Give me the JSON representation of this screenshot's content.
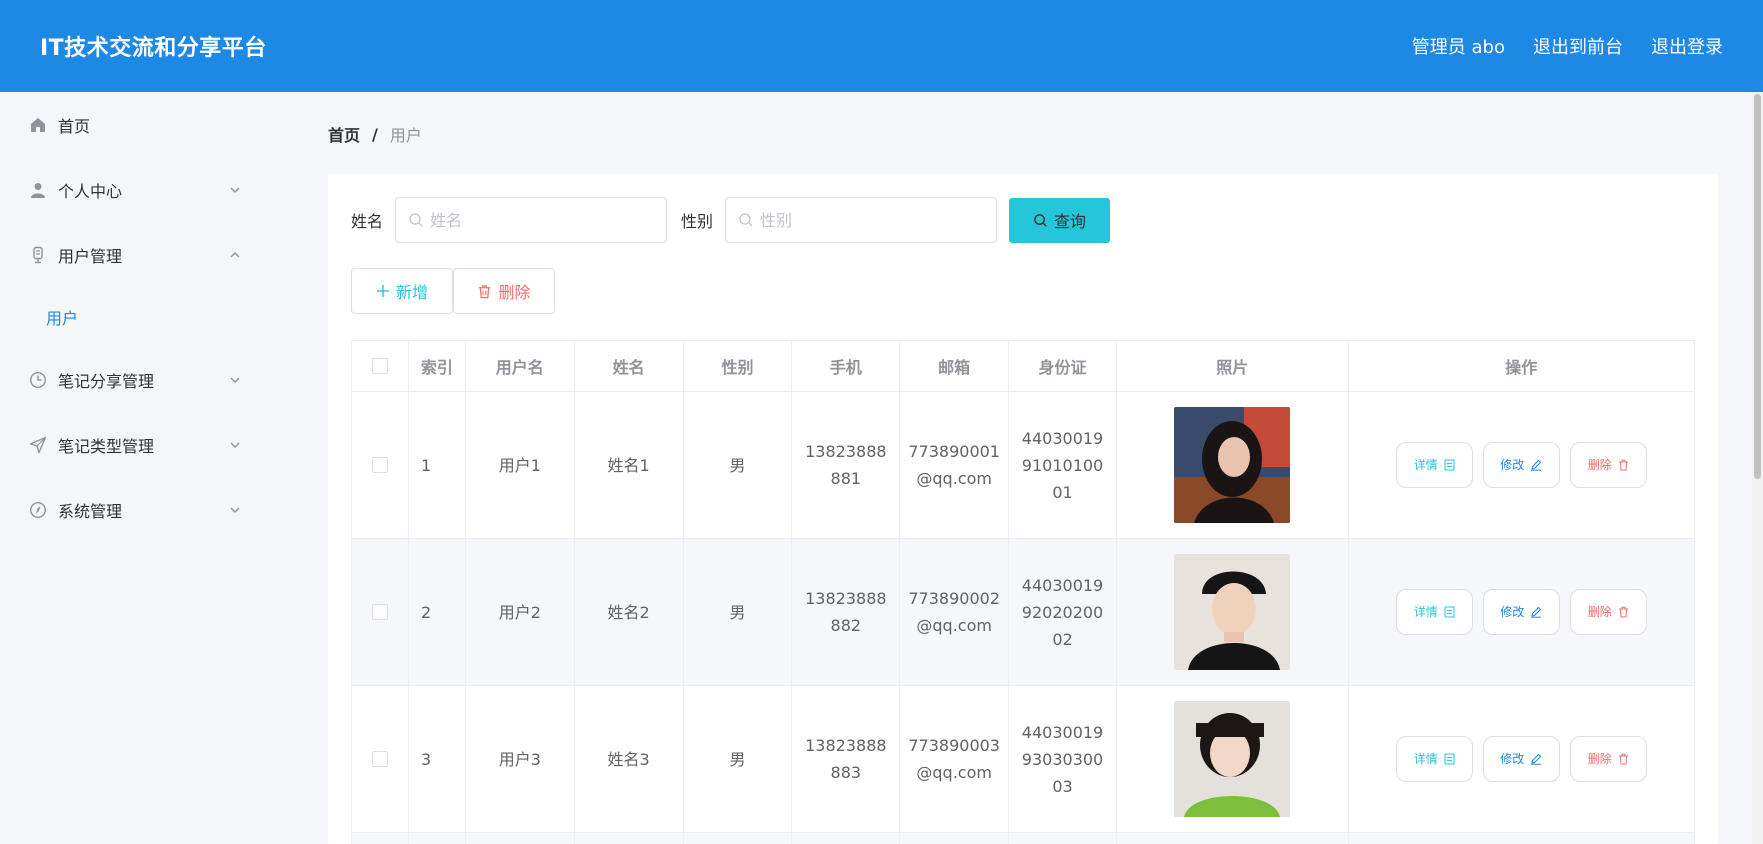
{
  "header": {
    "title": "IT技术交流和分享平台",
    "admin": "管理员 abo",
    "to_front": "退出到前台",
    "logout": "退出登录",
    "bg_color": "#1e88e5"
  },
  "sidebar": {
    "items": [
      {
        "label": "首页",
        "icon": "home-icon"
      },
      {
        "label": "个人中心",
        "icon": "user-icon",
        "expanded": false
      },
      {
        "label": "用户管理",
        "icon": "user-manage-icon",
        "expanded": true
      },
      {
        "label": "笔记分享管理",
        "icon": "clock-icon",
        "expanded": false
      },
      {
        "label": "笔记类型管理",
        "icon": "send-icon",
        "expanded": false
      },
      {
        "label": "系统管理",
        "icon": "compass-icon",
        "expanded": false
      }
    ],
    "sub_items": [
      {
        "label": "用户",
        "active": true
      }
    ]
  },
  "breadcrumb": {
    "home": "首页",
    "separator": "/",
    "current": "用户"
  },
  "search": {
    "name_label": "姓名",
    "name_placeholder": "姓名",
    "sex_label": "性别",
    "sex_placeholder": "性别",
    "query_button": "查询"
  },
  "actions": {
    "add": "新增",
    "delete": "删除"
  },
  "table": {
    "headers": [
      "索引",
      "用户名",
      "姓名",
      "性别",
      "手机",
      "邮箱",
      "身份证",
      "照片",
      "操作"
    ],
    "rows": [
      {
        "index": "1",
        "username": "用户1",
        "name": "姓名1",
        "sex": "男",
        "phone": "13823888881",
        "email": "773890001@qq.com",
        "id_card": "440300199101010001"
      },
      {
        "index": "2",
        "username": "用户2",
        "name": "姓名2",
        "sex": "男",
        "phone": "13823888882",
        "email": "773890002@qq.com",
        "id_card": "440300199202020002"
      },
      {
        "index": "3",
        "username": "用户3",
        "name": "姓名3",
        "sex": "男",
        "phone": "13823888883",
        "email": "773890003@qq.com",
        "id_card": "440300199303030003"
      }
    ],
    "op_detail": "详情",
    "op_edit": "修改",
    "op_delete": "删除"
  },
  "colors": {
    "accent": "#1e88e5",
    "query": "#26c6da",
    "danger": "#f56c6c"
  }
}
